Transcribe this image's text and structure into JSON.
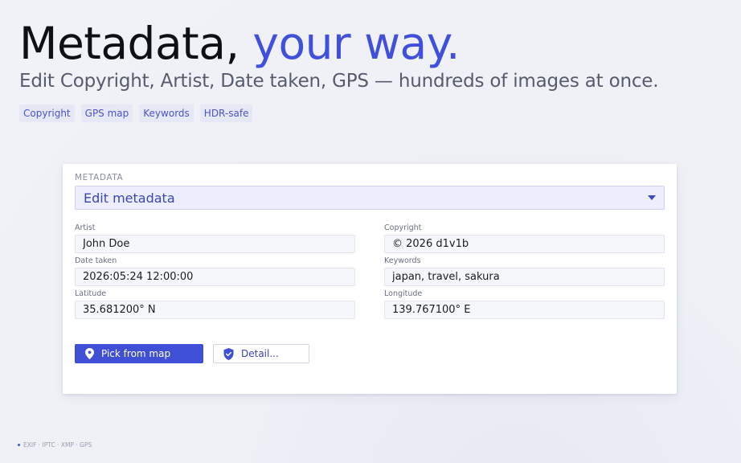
{
  "hero": {
    "headline_main": "Metadata,",
    "headline_accent": "your way.",
    "subhead": "Edit Copyright, Artist, Date taken, GPS — hundreds of images at once.",
    "chips": [
      "Copyright",
      "GPS map",
      "Keywords",
      "HDR-safe"
    ]
  },
  "card": {
    "section_label": "METADATA",
    "dropdown": {
      "selected": "Edit metadata"
    },
    "fields": {
      "artist": {
        "label": "Artist",
        "value": "John Doe"
      },
      "copyright": {
        "label": "Copyright",
        "value": "© 2026 d1v1b"
      },
      "date_taken": {
        "label": "Date taken",
        "value": "2026:05:24 12:00:00"
      },
      "keywords": {
        "label": "Keywords",
        "value": "japan, travel, sakura"
      },
      "latitude": {
        "label": "Latitude",
        "value": "35.681200° N"
      },
      "longitude": {
        "label": "Longitude",
        "value": "139.767100° E"
      }
    },
    "buttons": {
      "pick_map": {
        "label": "Pick from map",
        "icon": "map-pin-icon"
      },
      "detail": {
        "label": "Detail...",
        "icon": "shield-check-icon"
      }
    }
  },
  "footer": {
    "text": "EXIF · IPTC · XMP · GPS"
  },
  "colors": {
    "accent": "#4150dc",
    "primary_button": "#3f4fd6",
    "dropdown_bg": "#eceefc"
  }
}
